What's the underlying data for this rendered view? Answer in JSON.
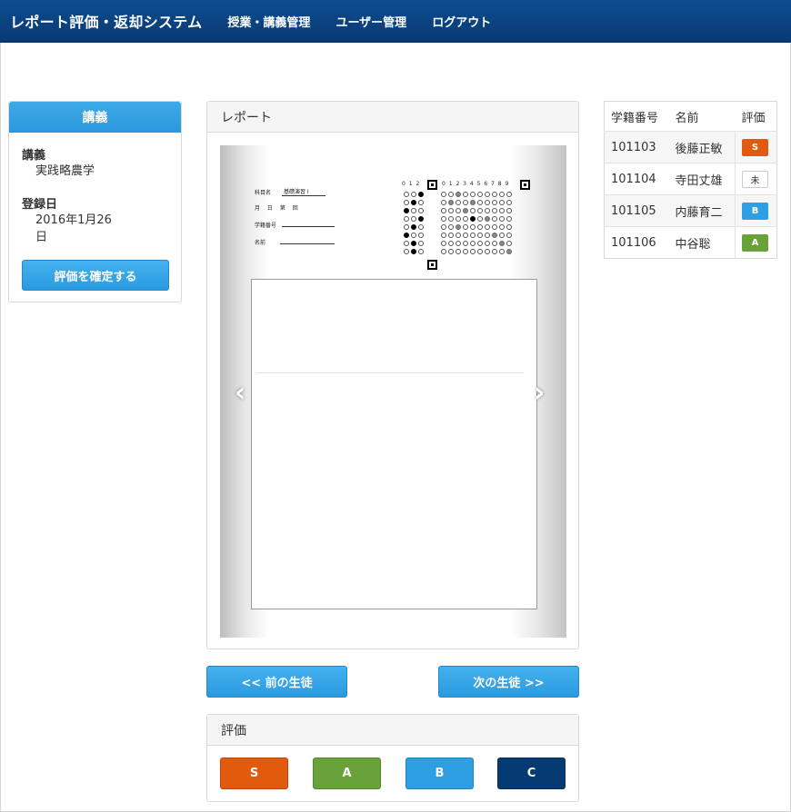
{
  "header": {
    "brand": "レポート評価・返却システム",
    "nav": [
      "授業・講義管理",
      "ユーザー管理",
      "ログアウト"
    ]
  },
  "lecture_panel": {
    "title": "講義",
    "lecture_label": "講義",
    "lecture_value": "実践略農学",
    "date_label": "登録日",
    "date_value": "2016年1月26日",
    "confirm_button": "評価を確定する"
  },
  "report_panel": {
    "title": "レポート",
    "sheet": {
      "subject_label": "科目名",
      "subject_value": "基礎演習 I",
      "date_line": "月 日 第 回",
      "student_id_label": "学籍番号",
      "name_label": "名前",
      "col_digits_left": "0 1 2",
      "col_digits_right": "0 1 2 3 4 5 6 7 8 9"
    }
  },
  "navigation": {
    "prev": "<< 前の生徒",
    "next": "次の生徒 >>"
  },
  "rating_panel": {
    "title": "評価",
    "grades": [
      {
        "label": "S",
        "color": "#e25a0e"
      },
      {
        "label": "A",
        "color": "#6aa23a"
      },
      {
        "label": "B",
        "color": "#2e9fe3"
      },
      {
        "label": "C",
        "color": "#063a73"
      }
    ]
  },
  "students": {
    "headers": [
      "学籍番号",
      "名前",
      "評価"
    ],
    "rows": [
      {
        "id": "101103",
        "name": "後藤正敏",
        "grade": "S",
        "grade_color": "#e25a0e"
      },
      {
        "id": "101104",
        "name": "寺田丈雄",
        "grade": "未",
        "grade_color": "#ffffff"
      },
      {
        "id": "101105",
        "name": "内藤育二",
        "grade": "B",
        "grade_color": "#2e9fe3"
      },
      {
        "id": "101106",
        "name": "中谷聡",
        "grade": "A",
        "grade_color": "#6aa23a"
      }
    ]
  },
  "colors": {
    "navbar": "#0a4382",
    "accent_blue": "#2e9fe3"
  }
}
